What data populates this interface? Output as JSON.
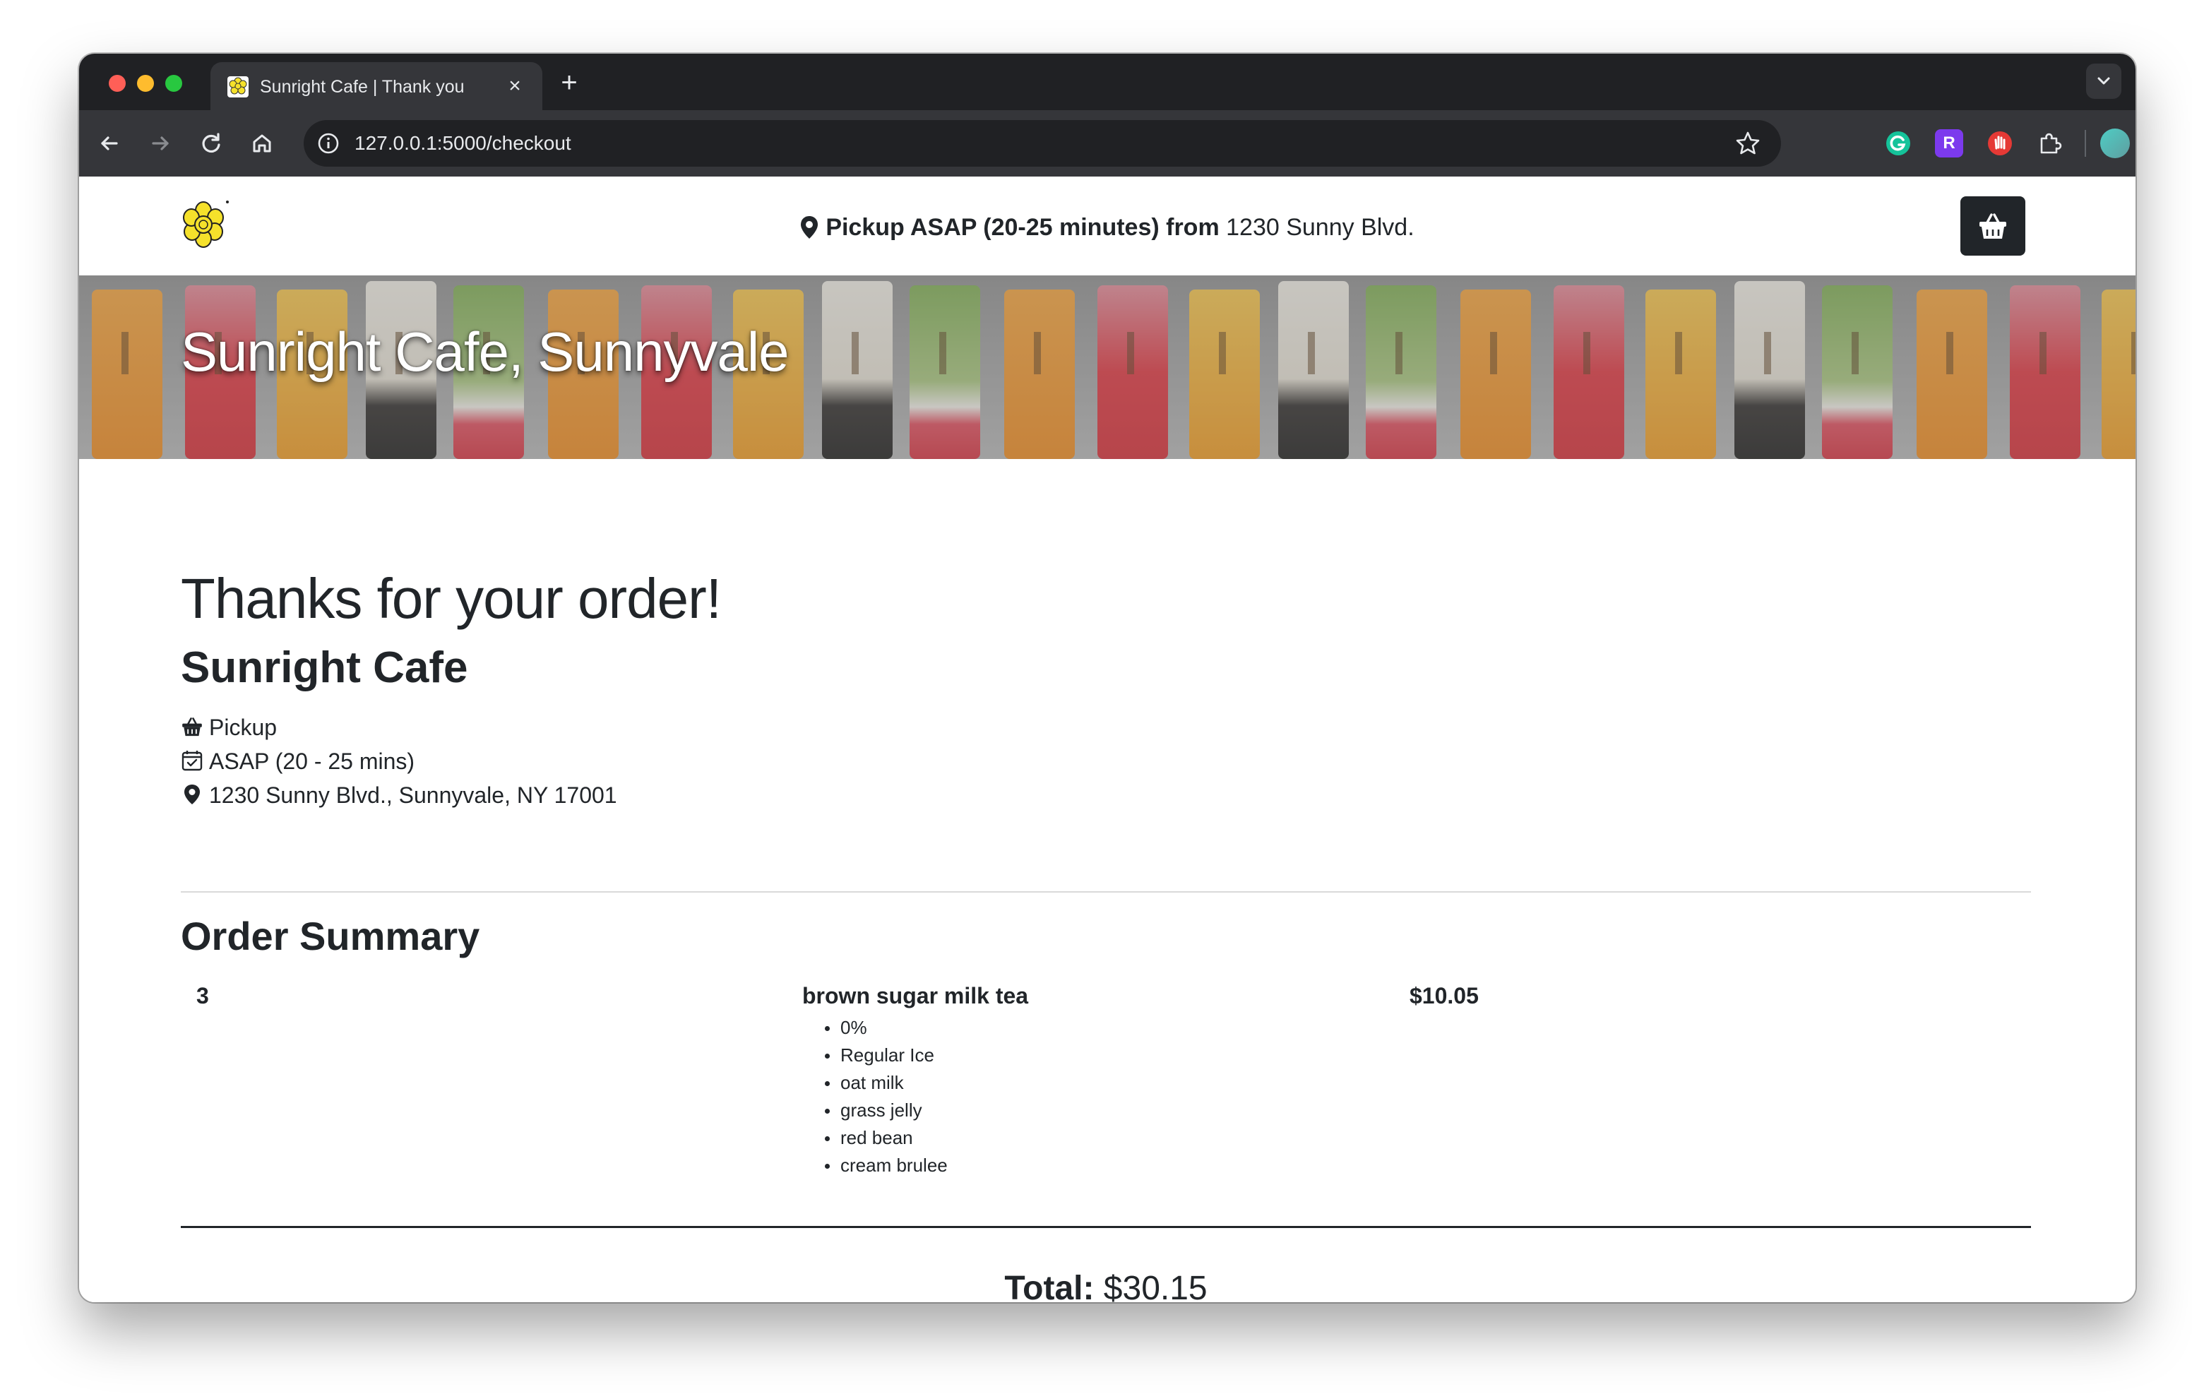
{
  "browser": {
    "tab_title": "Sunright Cafe | Thank you",
    "url": "127.0.0.1:5000/checkout",
    "extensions": [
      "grammarly-icon",
      "r-extension-icon",
      "hand-stop-icon",
      "puzzle-icon"
    ],
    "extension_r_letter": "R"
  },
  "header": {
    "pickup_label": "Pickup ASAP (20-25 minutes) from",
    "pickup_address": "1230 Sunny Blvd."
  },
  "hero": {
    "title": "Sunright Cafe, Sunnyvale"
  },
  "confirmation": {
    "heading": "Thanks for your order!",
    "cafe_name": "Sunright Cafe",
    "method": "Pickup",
    "time": "ASAP (20 - 25 mins)",
    "address": "1230 Sunny Blvd., Sunnyvale, NY 17001"
  },
  "summary": {
    "heading": "Order Summary",
    "items": [
      {
        "quantity": "3",
        "name": "brown sugar milk tea",
        "price": "$10.05",
        "options": [
          "0%",
          "Regular Ice",
          "oat milk",
          "grass jelly",
          "red bean",
          "cream brulee"
        ]
      }
    ],
    "total_label": "Total:",
    "total_value": "$30.15"
  },
  "colors": {
    "chrome_dark": "#202124",
    "chrome_toolbar": "#35363a",
    "text_primary": "#212529",
    "cart_button": "#212529",
    "logo_yellow": "#f5e12b"
  }
}
